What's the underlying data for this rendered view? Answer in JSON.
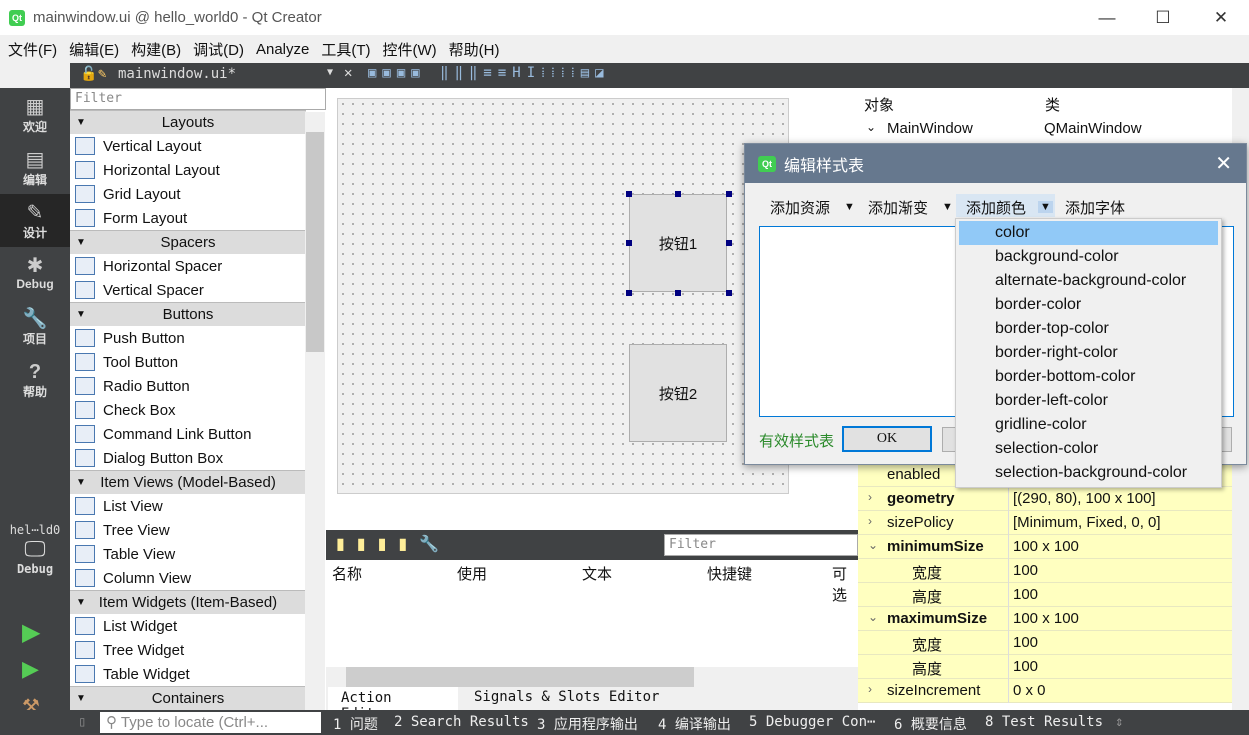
{
  "window": {
    "title": "mainwindow.ui @ hello_world0 - Qt Creator",
    "icon": "qt-logo"
  },
  "menu": [
    "文件(F)",
    "编辑(E)",
    "构建(B)",
    "调试(D)",
    "Analyze",
    "工具(T)",
    "控件(W)",
    "帮助(H)"
  ],
  "editor_tab": {
    "filename": "mainwindow.ui*"
  },
  "modes": [
    {
      "label": "欢迎",
      "icon": "grid-icon"
    },
    {
      "label": "编辑",
      "icon": "document-icon"
    },
    {
      "label": "设计",
      "icon": "pencil-icon",
      "active": true
    },
    {
      "label": "Debug",
      "icon": "bug-icon"
    },
    {
      "label": "项目",
      "icon": "wrench-icon"
    },
    {
      "label": "帮助",
      "icon": "help-icon"
    }
  ],
  "target": {
    "project": "hel⋯ld0",
    "config": "Debug"
  },
  "widgetbox": {
    "filter_placeholder": "Filter",
    "rows": [
      {
        "cat": true,
        "label": "Layouts"
      },
      {
        "label": "Vertical Layout"
      },
      {
        "label": "Horizontal Layout"
      },
      {
        "label": "Grid Layout"
      },
      {
        "label": "Form Layout"
      },
      {
        "cat": true,
        "label": "Spacers"
      },
      {
        "label": "Horizontal Spacer"
      },
      {
        "label": "Vertical Spacer"
      },
      {
        "cat": true,
        "label": "Buttons"
      },
      {
        "label": "Push Button"
      },
      {
        "label": "Tool Button"
      },
      {
        "label": "Radio Button"
      },
      {
        "label": "Check Box"
      },
      {
        "label": "Command Link Button"
      },
      {
        "label": "Dialog Button Box"
      },
      {
        "cat": true,
        "label": "Item Views (Model-Based)"
      },
      {
        "label": "List View"
      },
      {
        "label": "Tree View"
      },
      {
        "label": "Table View"
      },
      {
        "label": "Column View"
      },
      {
        "cat": true,
        "label": "Item Widgets (Item-Based)"
      },
      {
        "label": "List Widget"
      },
      {
        "label": "Tree Widget"
      },
      {
        "label": "Table Widget"
      },
      {
        "cat": true,
        "label": "Containers"
      }
    ]
  },
  "form": {
    "button1": "按钮1",
    "button2": "按钮2"
  },
  "action_editor": {
    "filter_placeholder": "Filter",
    "columns": [
      "名称",
      "使用",
      "文本",
      "快捷键",
      "可选"
    ],
    "tabs": [
      "Action Editor",
      "Signals & Slots Editor"
    ]
  },
  "object_inspector": {
    "columns": [
      "对象",
      "类"
    ],
    "rows": [
      {
        "object": "MainWindow",
        "class": "QMainWindow"
      }
    ]
  },
  "properties": [
    {
      "name": "enabled",
      "value": ""
    },
    {
      "name": "geometry",
      "value": "[(290, 80), 100 x 100]",
      "bold": true,
      "expand": "›"
    },
    {
      "name": "sizePolicy",
      "value": "[Minimum, Fixed, 0, 0]",
      "expand": "›"
    },
    {
      "name": "minimumSize",
      "value": "100 x 100",
      "bold": true,
      "expand": "⌄"
    },
    {
      "name": "宽度",
      "value": "100",
      "sub": true
    },
    {
      "name": "高度",
      "value": "100",
      "sub": true
    },
    {
      "name": "maximumSize",
      "value": "100 x 100",
      "bold": true,
      "expand": "⌄"
    },
    {
      "name": "宽度",
      "value": "100",
      "sub": true
    },
    {
      "name": "高度",
      "value": "100",
      "sub": true
    },
    {
      "name": "sizeIncrement",
      "value": "0 x 0",
      "expand": "›"
    }
  ],
  "dialog": {
    "title": "编辑样式表",
    "toolbar": [
      "添加资源",
      "添加渐变",
      "添加颜色",
      "添加字体"
    ],
    "status": "有效样式表",
    "status_color": "#2a8a2a",
    "ok": "OK"
  },
  "color_menu": {
    "items": [
      "color",
      "background-color",
      "alternate-background-color",
      "border-color",
      "border-top-color",
      "border-right-color",
      "border-bottom-color",
      "border-left-color",
      "gridline-color",
      "selection-color",
      "selection-background-color"
    ],
    "selected": "color",
    "highlight": "#91c9f7"
  },
  "statusbar": {
    "locate_placeholder": "Type to locate (Ctrl+...",
    "outputs": [
      "1 问题",
      "2 Search Results",
      "3 应用程序输出",
      "4 编译输出",
      "5 Debugger Con⋯",
      "6 概要信息",
      "8 Test Results"
    ]
  }
}
